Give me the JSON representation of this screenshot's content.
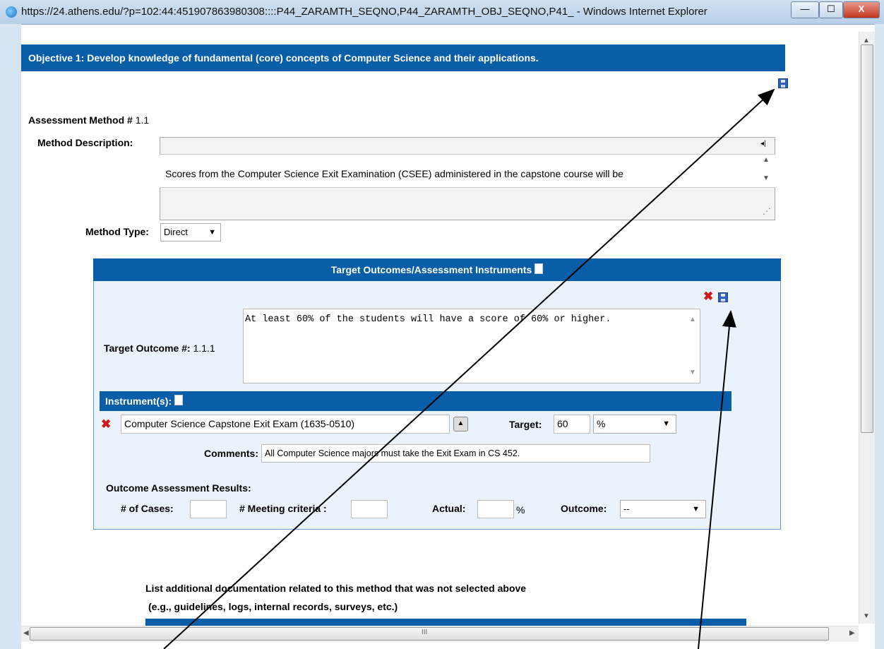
{
  "window": {
    "title": "https://24.athens.edu/?p=102:44:451907863980308::::P44_ZARAMTH_SEQNO,P44_ZARAMTH_OBJ_SEQNO,P41_ - Windows Internet Explorer",
    "minimize": "—",
    "maximize": "☐",
    "close": "X"
  },
  "objective": {
    "title": "Objective 1: Develop knowledge of fundamental (core) concepts of Computer Science and their applications."
  },
  "assessment": {
    "method_label": "Assessment Method #",
    "method_number": "1.1",
    "description_label": "Method Description:",
    "description_text": "Scores from the Computer Science Exit Examination (CSEE) administered in the capstone course will be",
    "type_label": "Method Type:",
    "type_value": "Direct"
  },
  "target_panel": {
    "header": "Target Outcomes/Assessment Instruments",
    "outcome_label": "Target Outcome #:",
    "outcome_number": "1.1.1",
    "outcome_text": "At least 60% of the students will have a score of 60% or higher.",
    "instruments_header": "Instrument(s):",
    "instrument_value": "Computer Science Capstone Exit Exam (1635-0510)",
    "target_label": "Target:",
    "target_value": "60",
    "target_unit": "%",
    "comments_label": "Comments:",
    "comments_value": "All Computer Science majors must take the Exit Exam in CS 452.",
    "results_header": "Outcome Assessment Results:",
    "cases_label": "# of Cases:",
    "meeting_label": "# Meeting criteria :",
    "actual_label": "Actual:",
    "actual_unit": "%",
    "outcome_label2": "Outcome:",
    "outcome_value": "--"
  },
  "additional": {
    "line1": "List additional documentation related to this method that was not selected above",
    "line2": "(e.g., guidelines, logs, internal records, surveys, etc.)"
  },
  "scroll": {
    "h_thumb_grip": "III"
  }
}
